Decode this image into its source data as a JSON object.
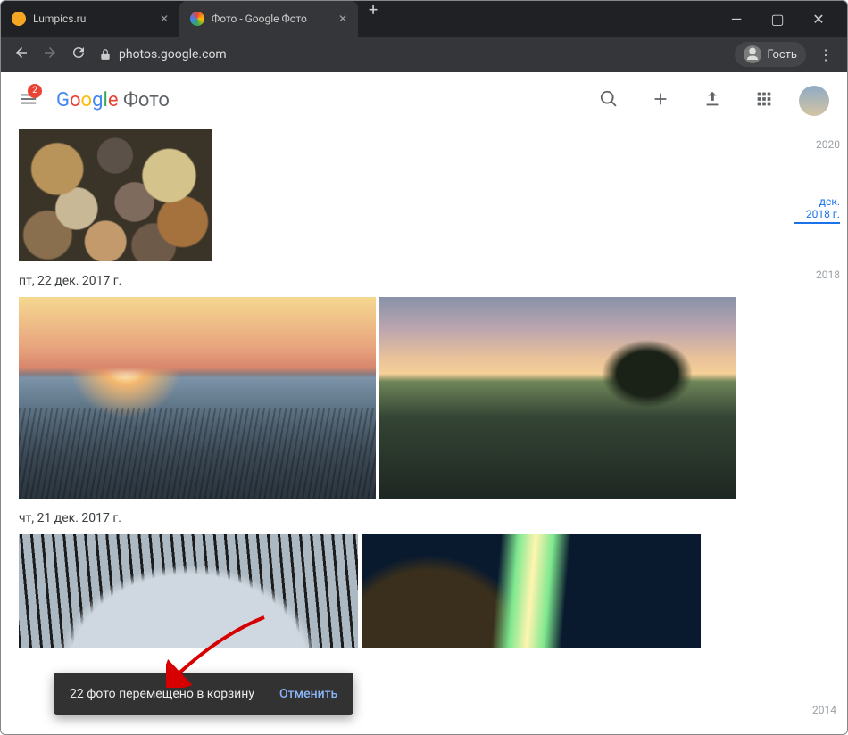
{
  "browser": {
    "tabs": [
      {
        "title": "Lumpics.ru",
        "active": false
      },
      {
        "title": "Фото - Google Фото",
        "active": true
      }
    ],
    "url": "photos.google.com",
    "guest_label": "Гость"
  },
  "header": {
    "badge": "2",
    "logo_product": "Фото"
  },
  "dates": {
    "d1": "пт, 22 дек. 2017 г.",
    "d2": "чт, 21 дек. 2017 г."
  },
  "timeline": {
    "y2020": "2020",
    "current": "дек. 2018 г.",
    "y2018": "2018",
    "y2014": "2014"
  },
  "toast": {
    "message": "22 фото перемещено в корзину",
    "action": "Отменить"
  }
}
